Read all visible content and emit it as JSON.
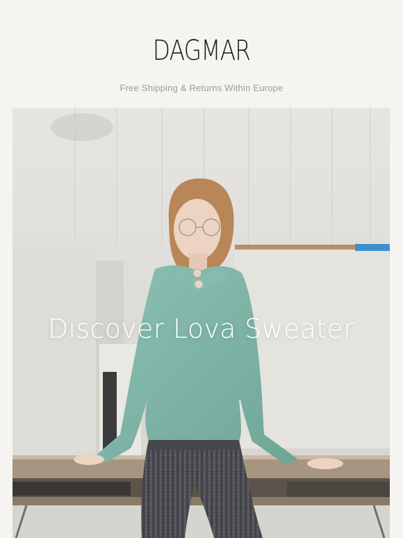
{
  "brand": {
    "logo_text": "DAGMAR"
  },
  "banner": {
    "shipping_text": "Free Shipping & Returns Within Europe"
  },
  "hero": {
    "title": "Discover Lova Sweater",
    "image_alt": "Model in mint green knit sweater and grey pinstripe trousers leaning on a table"
  },
  "colors": {
    "background": "#f5f4f0",
    "sweater": "#7fb5a8",
    "trousers": "#4a4b50",
    "wall": "#e2e1dc"
  }
}
